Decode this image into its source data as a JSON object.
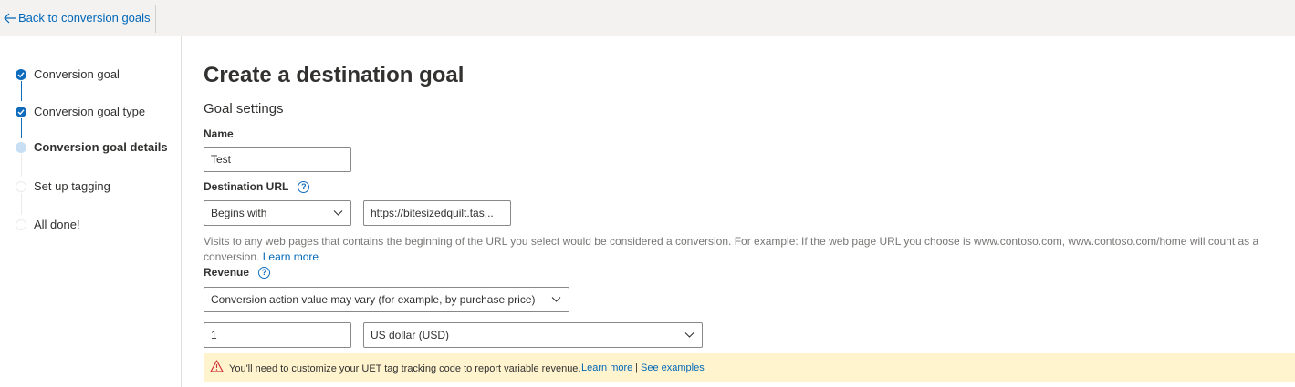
{
  "topbar": {
    "back_label": "Back to conversion goals"
  },
  "steps": [
    {
      "label": "Conversion goal",
      "state": "done"
    },
    {
      "label": "Conversion goal type",
      "state": "done"
    },
    {
      "label": "Conversion goal details",
      "state": "current"
    },
    {
      "label": "Set up tagging",
      "state": "todo"
    },
    {
      "label": "All done!",
      "state": "todo"
    }
  ],
  "main": {
    "title": "Create a destination goal",
    "section_title": "Goal settings",
    "name": {
      "label": "Name",
      "value": "Test"
    },
    "destination_url": {
      "label": "Destination URL",
      "help_icon": "?",
      "match_type": "Begins with",
      "url_value": "https://bitesizedquilt.tas...",
      "help_text": "Visits to any web pages that contains the beginning of the URL you select would be considered a conversion. For example: If the web page URL you choose is www.contoso.com, www.contoso.com/home will count as a conversion.",
      "learn_more": "Learn more"
    },
    "revenue": {
      "label": "Revenue",
      "help_icon": "?",
      "type": "Conversion action value may vary (for example, by purchase price)",
      "amount": "1",
      "currency": "US dollar (USD)"
    },
    "warning": {
      "message": "You'll need to customize your UET tag tracking code to report variable revenue.",
      "learn_more": "Learn more",
      "separator": "|",
      "see_examples": "See examples"
    }
  },
  "colors": {
    "accent": "#0f6cbd",
    "link": "#0067b8",
    "warning_bg": "#fff4ce",
    "warning_icon": "#d13438"
  }
}
